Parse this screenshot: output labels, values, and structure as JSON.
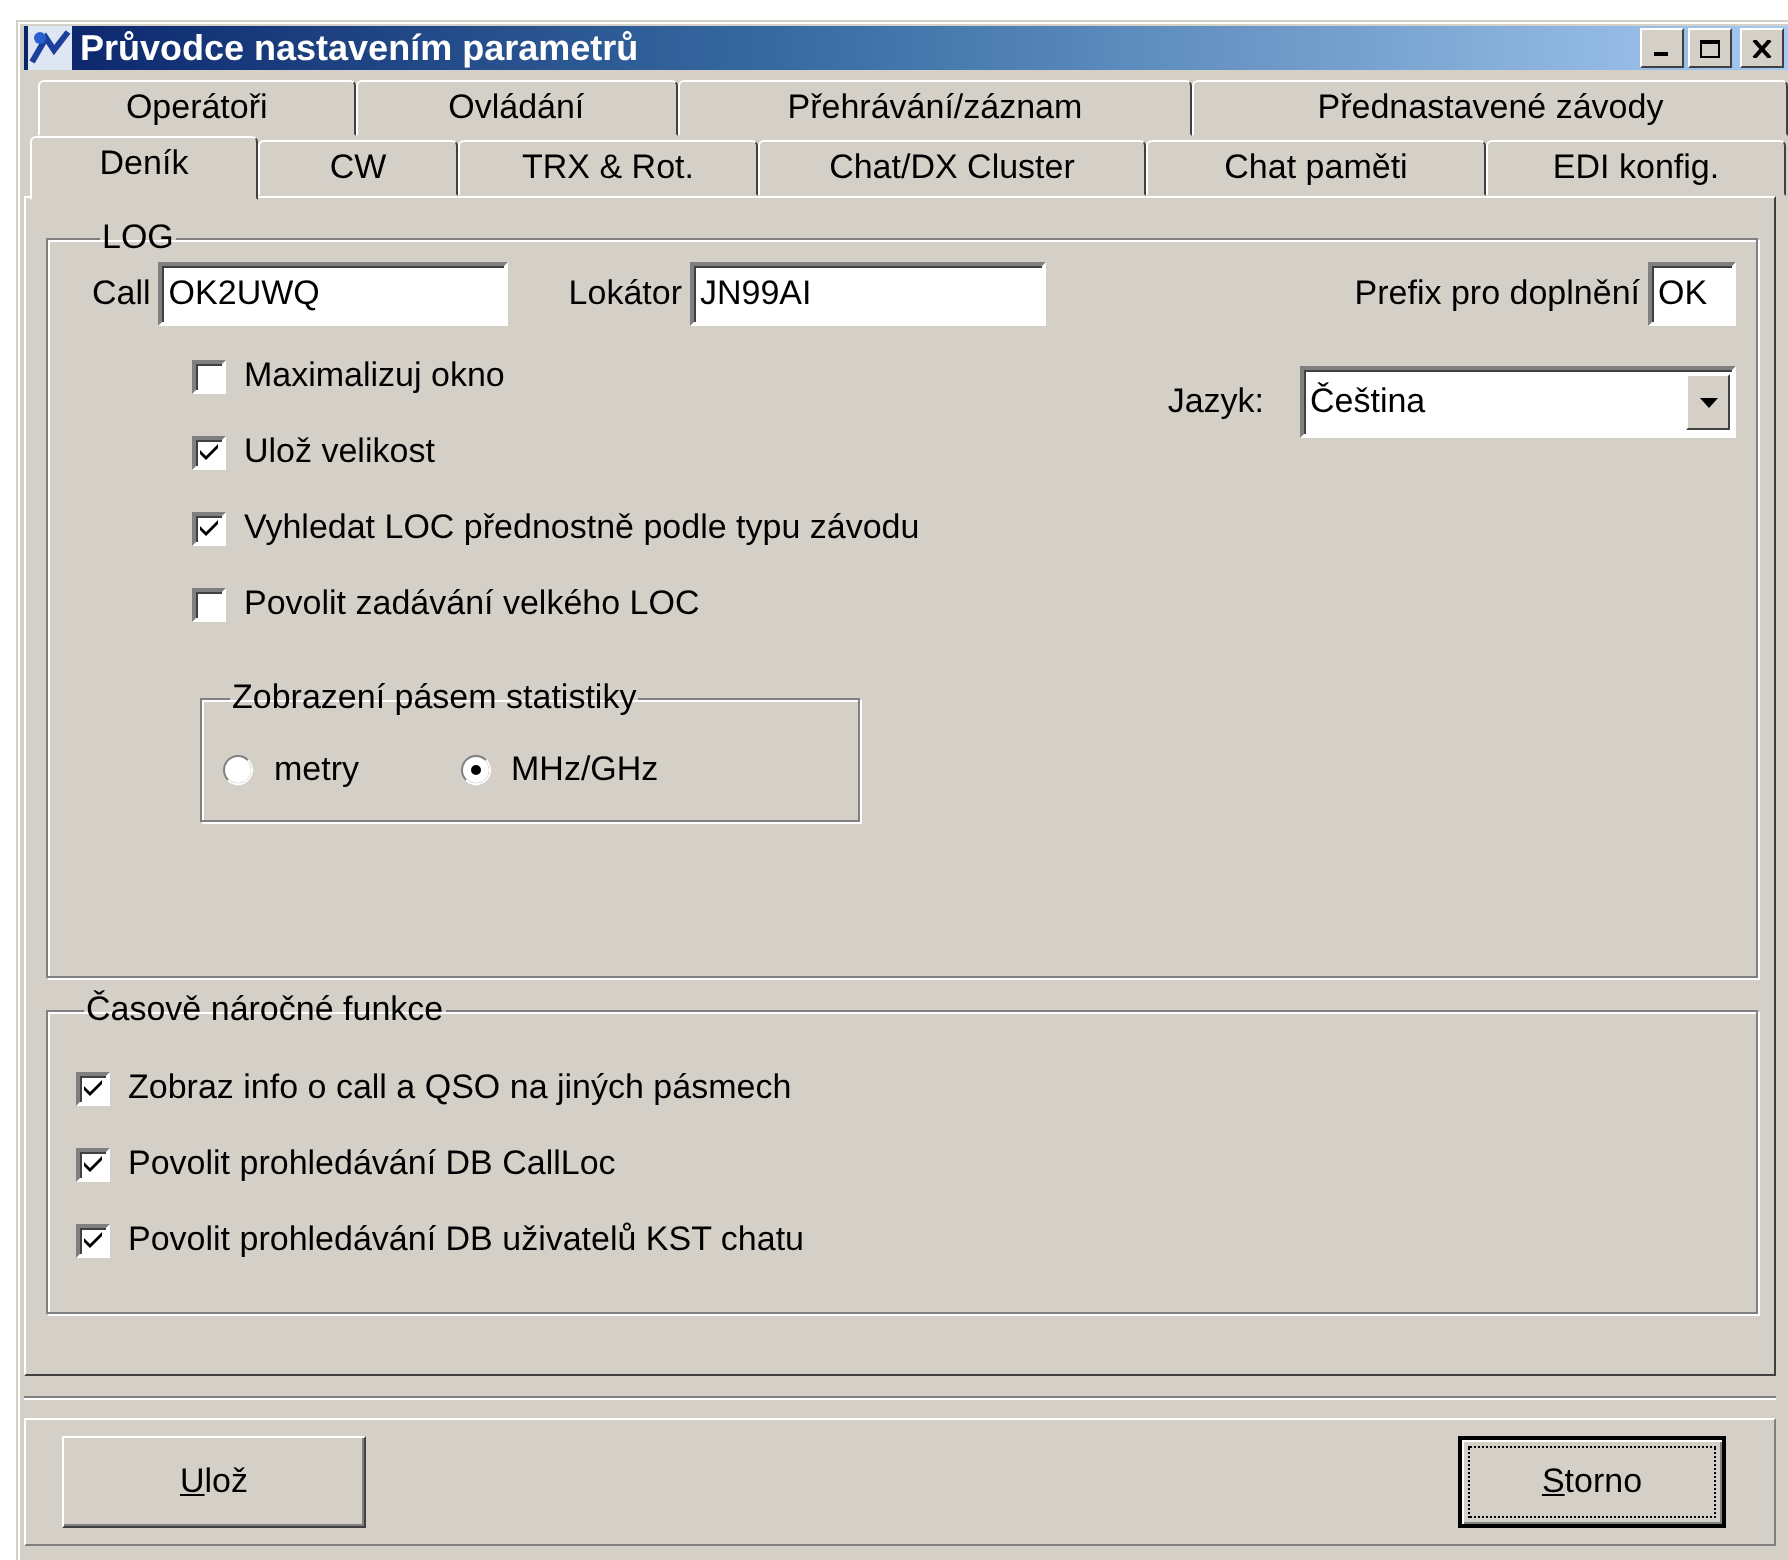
{
  "window": {
    "title": "Průvodce nastavením parametrů"
  },
  "tab_rows": [
    {
      "tabs": [
        {
          "label": "Operátoři",
          "selected": false
        },
        {
          "label": "Ovládání",
          "selected": false
        },
        {
          "label": "Přehrávání/záznam",
          "selected": false
        },
        {
          "label": "Přednastavené závody",
          "selected": false
        }
      ]
    },
    {
      "tabs": [
        {
          "label": "Deník",
          "selected": true
        },
        {
          "label": "CW",
          "selected": false
        },
        {
          "label": "TRX & Rot.",
          "selected": false
        },
        {
          "label": "Chat/DX Cluster",
          "selected": false
        },
        {
          "label": "Chat paměti",
          "selected": false
        },
        {
          "label": "EDI konfig.",
          "selected": false
        }
      ]
    }
  ],
  "log_group": {
    "title": "LOG",
    "fields": [
      {
        "label": "Call",
        "value": "OK2UWQ"
      },
      {
        "label": "Lokátor",
        "value": "JN99AI"
      },
      {
        "label": "Prefix pro doplnění",
        "value": "OK"
      }
    ],
    "checkboxes": [
      {
        "label": "Maximalizuj okno",
        "checked": false
      },
      {
        "label": "Ulož velikost",
        "checked": true
      },
      {
        "label": "Vyhledat LOC přednostně podle typu závodu",
        "checked": true
      },
      {
        "label": "Povolit zadávání velkého LOC",
        "checked": false
      }
    ],
    "language": {
      "label": "Jazyk:",
      "value": "Čeština"
    },
    "statistics_group": {
      "title": "Zobrazení pásem statistiky",
      "options": [
        {
          "label": "metry",
          "selected": false
        },
        {
          "label": "MHz/GHz",
          "selected": true
        }
      ]
    }
  },
  "time_group": {
    "title": "Časově náročné funkce",
    "checkboxes": [
      {
        "label": "Zobraz info o call a QSO na jiných pásmech",
        "checked": true
      },
      {
        "label": "Povolit prohledávání DB CallLoc",
        "checked": true
      },
      {
        "label": "Povolit prohledávání DB uživatelů KST chatu",
        "checked": true
      }
    ]
  },
  "buttons": [
    {
      "label": "Ulož",
      "default": false
    },
    {
      "label": "Storno",
      "default": true
    }
  ]
}
